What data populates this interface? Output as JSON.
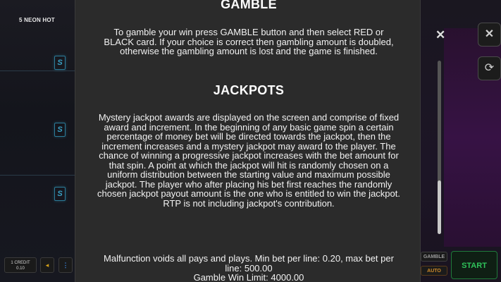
{
  "game": {
    "title": "5 NEON HOT",
    "credit_label": "1 CREDIT",
    "credit_value": "0.10",
    "start_label": "START",
    "gamble_label": "GAMBLE",
    "auto_label": "AUTO"
  },
  "icons": {
    "close": "close-icon",
    "exit": "exit-icon",
    "history": "history-icon",
    "sound": "speaker-icon",
    "info": "info-icon",
    "reel_symbol": "S"
  },
  "help": {
    "gamble_title": "GAMBLE",
    "gamble_text": "To gamble your win press GAMBLE button and then select RED or BLACK card. If your choice is correct then gambling amount is doubled, otherwise the gambling amount is lost and the game is finished.",
    "jackpots_title": "JACKPOTS",
    "jackpots_text": "Mystery jackpot awards are displayed on the screen and comprise of fixed award and increment. In the beginning of any basic game spin a certain percentage of money bet will be directed towards the jackpot, then the increment increases and a mystery jackpot may award to the player. The chance of winning a progressive jackpot increases with the bet amount for that spin. A point at which the jackpot will hit is randomly chosen on a uniform distribution between the starting value and maximum possible jackpot. The player who after placing his bet first reaches the randomly chosen jackpot payout amount is the one who is entitled to win the jackpot. RTP is not including jackpot's contribution.",
    "malfunction_text": "Malfunction voids all pays and plays. Min bet per line: 0.20, max bet per line: 500.00",
    "gamble_limit_text": "Gamble Win Limit: 4000.00"
  },
  "colors": {
    "panel_bg": "#2b2b2b",
    "reel_accent": "#3aa3c8",
    "start_green": "#2fc25a",
    "auto_orange": "#d08b2a"
  }
}
